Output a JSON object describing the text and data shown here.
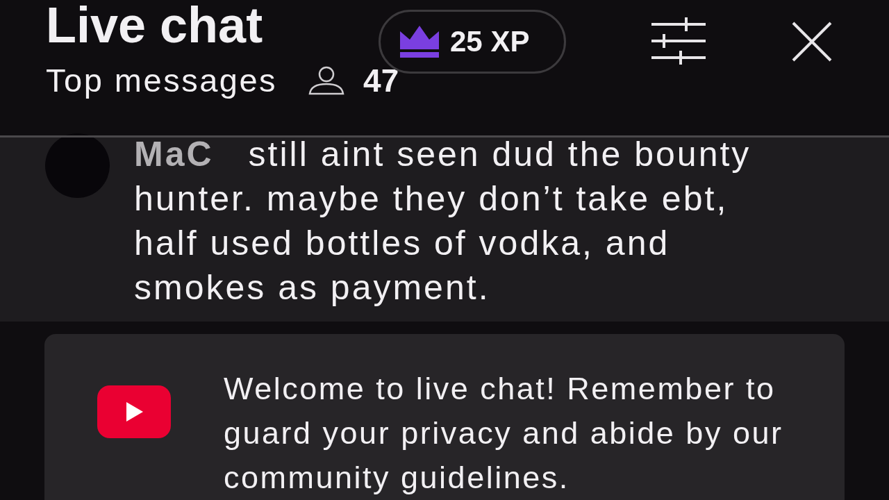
{
  "header": {
    "title": "Live chat",
    "mode": "Top messages",
    "viewer_count": "47",
    "xp_badge": "25 XP"
  },
  "messages": [
    {
      "author": "MaC",
      "text": "still aint seen dud the bounty hunter. maybe they don’t take ebt, half used bottles of vodka, and smokes as payment."
    }
  ],
  "banner": {
    "text": "Welcome to live chat! Remember to guard your privacy and abide by our community guidelines."
  }
}
